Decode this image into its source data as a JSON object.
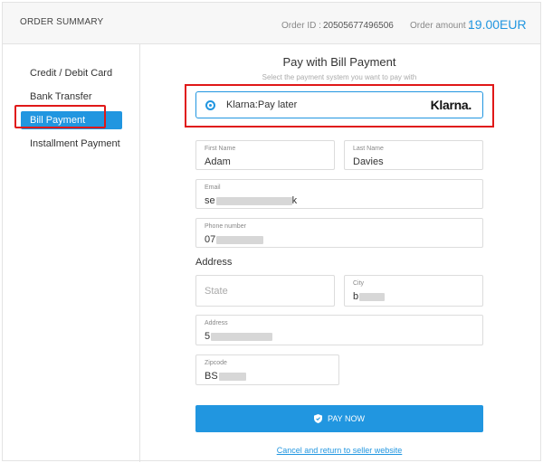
{
  "header": {
    "title": "ORDER SUMMARY",
    "order_id_label": "Order ID :",
    "order_id": "20505677496506",
    "amount_label": "Order amount :",
    "amount": "19.00EUR"
  },
  "sidebar": {
    "items": [
      {
        "label": "Credit / Debit Card",
        "active": false
      },
      {
        "label": "Bank Transfer",
        "active": false
      },
      {
        "label": "Bill Payment",
        "active": true
      },
      {
        "label": "Installment Payment",
        "active": false
      }
    ]
  },
  "main": {
    "title": "Pay with Bill Payment",
    "subtitle": "Select the payment system you want to pay with",
    "option": {
      "label": "Klarna:Pay later",
      "logo": "Klarna.",
      "selected": true
    },
    "form": {
      "first_name": {
        "label": "First Name",
        "value": "Adam"
      },
      "last_name": {
        "label": "Last Name",
        "value": "Davies"
      },
      "email": {
        "label": "Email",
        "value_start": "se",
        "value_end": "k"
      },
      "phone": {
        "label": "Phone number",
        "value_start": "07"
      },
      "address_section": "Address",
      "state": {
        "placeholder": "State"
      },
      "city": {
        "label": "City",
        "value_start": "b"
      },
      "address": {
        "label": "Address",
        "value_start": "5"
      },
      "zipcode": {
        "label": "Zipcode",
        "value_start": "BS"
      }
    },
    "pay_button": "PAY NOW",
    "cancel_link": "Cancel and return to seller website"
  },
  "colors": {
    "accent": "#2196e0",
    "highlight": "#e01818"
  },
  "icons": {
    "radio": "radio-selected-icon",
    "pay": "shield-check-icon"
  }
}
